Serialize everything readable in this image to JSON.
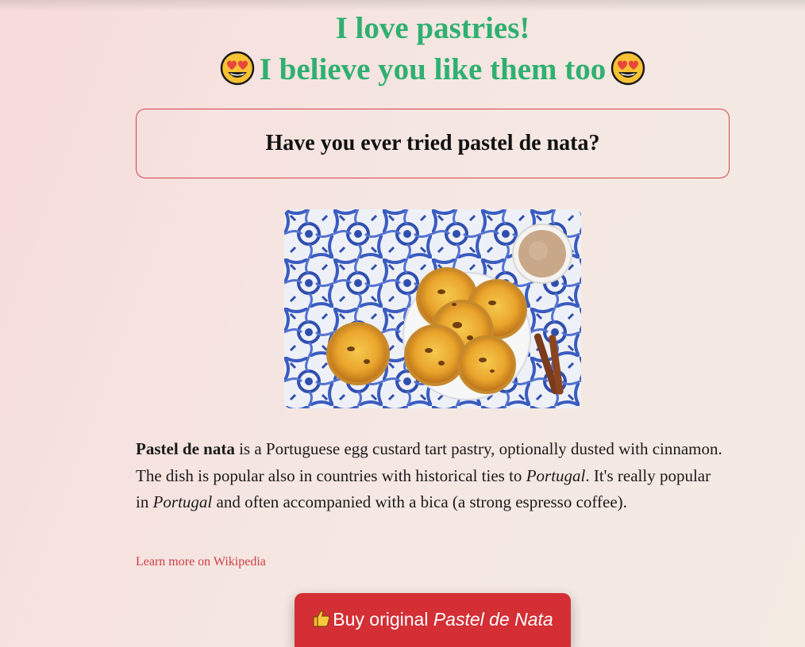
{
  "header": {
    "title_line1": "I love pastries!",
    "title_line2": "I believe you like them too",
    "emoji_icon": "heart-eyes-emoji"
  },
  "question": {
    "text": "Have you ever tried pastel de nata?"
  },
  "photo": {
    "subject": "pastel-de-nata-photo"
  },
  "description": {
    "bold_term": "Pastel de nata",
    "part1": " is a Portuguese egg custard tart pastry, optionally dusted with cinnamon. The dish is popular also in countries with historical ties to ",
    "italic1": "Portugal",
    "part2": ". It's really popular in ",
    "italic2": "Portugal",
    "part3": " and often accompanied with a bica (a strong espresso coffee)."
  },
  "link": {
    "label": "Learn more on Wikipedia"
  },
  "buy_button": {
    "prefix": "Buy original ",
    "product": "Pastel de Nata",
    "icon": "thumbs-up-icon"
  },
  "colors": {
    "accent_green": "#2fb06f",
    "accent_red": "#d32f35",
    "link_red": "#cf3d44"
  }
}
